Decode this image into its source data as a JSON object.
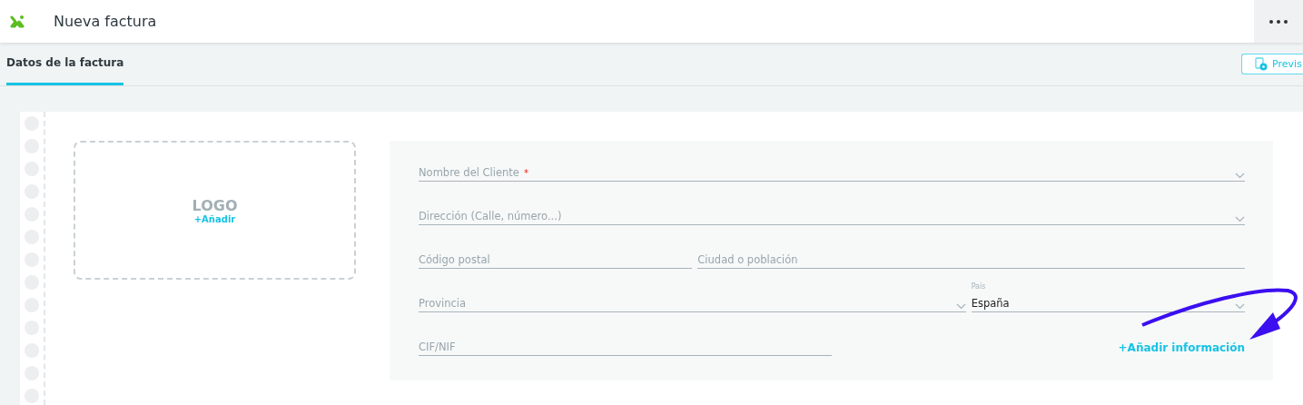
{
  "header": {
    "title": "Nueva factura"
  },
  "tabs": [
    {
      "label": "Datos de la factura",
      "selected": true
    }
  ],
  "preview_button": {
    "label": "Previs"
  },
  "logo_box": {
    "title": "LOGO",
    "action": "+Añadir"
  },
  "form_rows": [
    {
      "items": [
        {
          "kind": "select",
          "label": "Nombre del Cliente",
          "required_mark": "*"
        }
      ]
    },
    {
      "items": [
        {
          "kind": "select",
          "label": "Dirección (Calle, número...)"
        }
      ]
    },
    {
      "items": [
        {
          "kind": "text",
          "label": "Código postal"
        },
        {
          "kind": "text",
          "label": "Ciudad o población"
        }
      ]
    },
    {
      "items": [
        {
          "kind": "select",
          "label": "Provincia"
        },
        {
          "kind": "select",
          "label": "País",
          "value": "España"
        }
      ]
    },
    {
      "items": [
        {
          "kind": "text",
          "label": "CIF/NIF"
        },
        {
          "kind": "link",
          "label": "+Añadir información"
        }
      ]
    }
  ]
}
